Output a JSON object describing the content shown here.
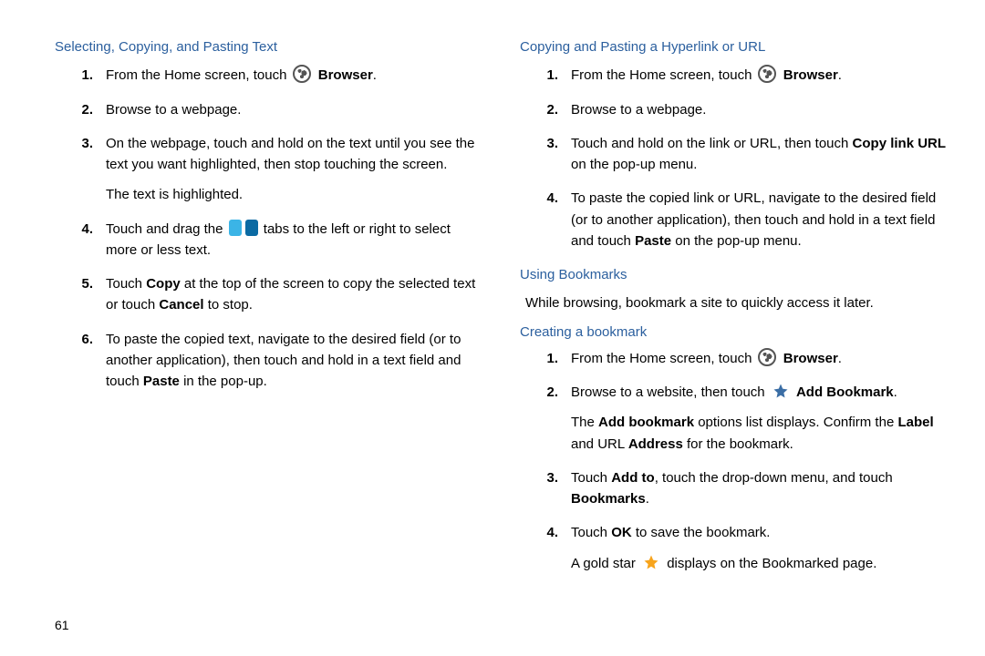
{
  "pageNumber": "61",
  "left": {
    "heading": "Selecting, Copying, and Pasting Text",
    "steps": [
      {
        "num": "1.",
        "pre": "From the Home screen, touch ",
        "icon": "globe",
        "post": "",
        "bold_post": "Browser",
        "tail": "."
      },
      {
        "num": "2.",
        "text": "Browse to a webpage."
      },
      {
        "num": "3.",
        "text": "On the webpage, touch and hold on the text until you see the text you want highlighted, then stop touching the screen.",
        "cont": "The text is highlighted."
      },
      {
        "num": "4.",
        "pre": "Touch and drag the ",
        "icon": "tabs",
        "post": " tabs to the left or right to select more or less text."
      },
      {
        "num": "5.",
        "parts": [
          {
            "t": "Touch "
          },
          {
            "b": "Copy"
          },
          {
            "t": " at the top of the screen to copy the selected text or touch "
          },
          {
            "b": "Cancel"
          },
          {
            "t": " to stop."
          }
        ]
      },
      {
        "num": "6.",
        "parts": [
          {
            "t": "To paste the copied text, navigate to the desired field (or to another application), then touch and hold in a text field and touch "
          },
          {
            "b": "Paste"
          },
          {
            "t": " in the pop-up."
          }
        ]
      }
    ]
  },
  "right": {
    "heading1": "Copying and Pasting a Hyperlink or URL",
    "steps1": [
      {
        "num": "1.",
        "pre": "From the Home screen, touch ",
        "icon": "globe",
        "bold_post": "Browser",
        "tail": "."
      },
      {
        "num": "2.",
        "text": "Browse to a webpage."
      },
      {
        "num": "3.",
        "parts": [
          {
            "t": "Touch and hold on the link or URL, then touch "
          },
          {
            "b": "Copy link URL"
          },
          {
            "t": " on the pop-up menu."
          }
        ]
      },
      {
        "num": "4.",
        "parts": [
          {
            "t": "To paste the copied link or URL, navigate to the desired field (or to another application), then touch and hold in a text field and touch "
          },
          {
            "b": "Paste"
          },
          {
            "t": " on the pop-up menu."
          }
        ]
      }
    ],
    "heading2": "Using Bookmarks",
    "intro2": "While browsing, bookmark a site to quickly access it later.",
    "heading3": "Creating a bookmark",
    "steps3": [
      {
        "num": "1.",
        "pre": "From the Home screen, touch ",
        "icon": "globe",
        "bold_post": "Browser",
        "tail": "."
      },
      {
        "num": "2.",
        "pre": "Browse to a website, then touch ",
        "icon": "star-blue",
        "bold_post": "Add Bookmark",
        "tail": ".",
        "cont_parts": [
          {
            "t": "The "
          },
          {
            "b": "Add bookmark"
          },
          {
            "t": " options list displays. Confirm the "
          },
          {
            "b": "Label"
          },
          {
            "t": " and URL "
          },
          {
            "b": "Address"
          },
          {
            "t": " for the bookmark."
          }
        ]
      },
      {
        "num": "3.",
        "parts": [
          {
            "t": "Touch "
          },
          {
            "b": "Add to"
          },
          {
            "t": ", touch the drop-down menu, and touch "
          },
          {
            "b": "Bookmarks"
          },
          {
            "t": "."
          }
        ]
      },
      {
        "num": "4.",
        "parts": [
          {
            "t": "Touch "
          },
          {
            "b": "OK"
          },
          {
            "t": " to save the bookmark."
          }
        ],
        "cont_pre": "A gold star ",
        "cont_icon": "star-gold",
        "cont_post": " displays on the Bookmarked page."
      }
    ]
  }
}
